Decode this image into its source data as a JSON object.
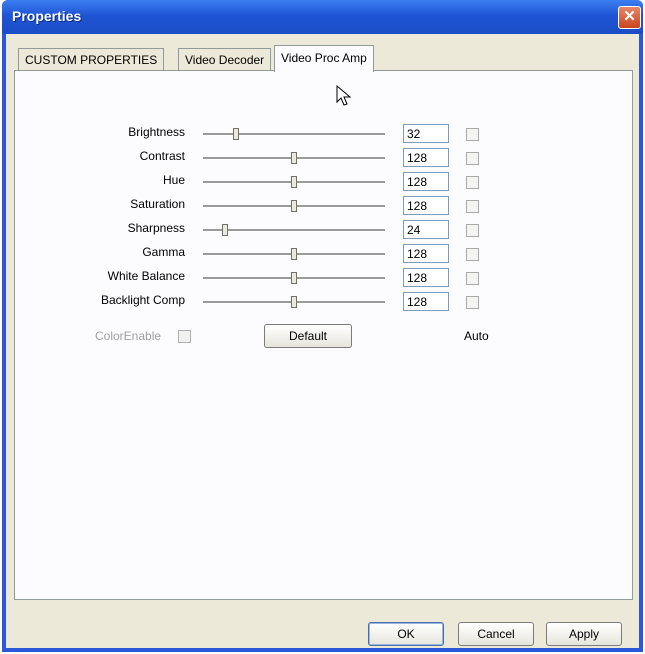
{
  "window": {
    "title": "Properties",
    "close_glyph": "✕"
  },
  "tabs": [
    {
      "label": "CUSTOM PROPERTIES",
      "active": false
    },
    {
      "label": "Video Decoder",
      "active": false
    },
    {
      "label": "Video Proc Amp",
      "active": true
    }
  ],
  "controls": [
    {
      "label": "Brightness",
      "value": "32",
      "level": 0.18,
      "auto": false
    },
    {
      "label": "Contrast",
      "value": "128",
      "level": 0.5,
      "auto": false
    },
    {
      "label": "Hue",
      "value": "128",
      "level": 0.5,
      "auto": false
    },
    {
      "label": "Saturation",
      "value": "128",
      "level": 0.5,
      "auto": false
    },
    {
      "label": "Sharpness",
      "value": "24",
      "level": 0.12,
      "auto": false
    },
    {
      "label": "Gamma",
      "value": "128",
      "level": 0.5,
      "auto": false
    },
    {
      "label": "White Balance",
      "value": "128",
      "level": 0.5,
      "auto": false
    },
    {
      "label": "Backlight Comp",
      "value": "128",
      "level": 0.5,
      "auto": false
    }
  ],
  "color_enable": {
    "label": "ColorEnable",
    "checked": false
  },
  "default_label": "Default",
  "auto_label": "Auto",
  "buttons": {
    "ok": "OK",
    "cancel": "Cancel",
    "apply": "Apply"
  },
  "colors": {
    "title_bar": "#2a58d8",
    "dialog_bg": "#ece9d8",
    "close_button": "#c8451e"
  },
  "icons": {
    "close": "close-icon",
    "cursor": "mouse-pointer-icon"
  }
}
